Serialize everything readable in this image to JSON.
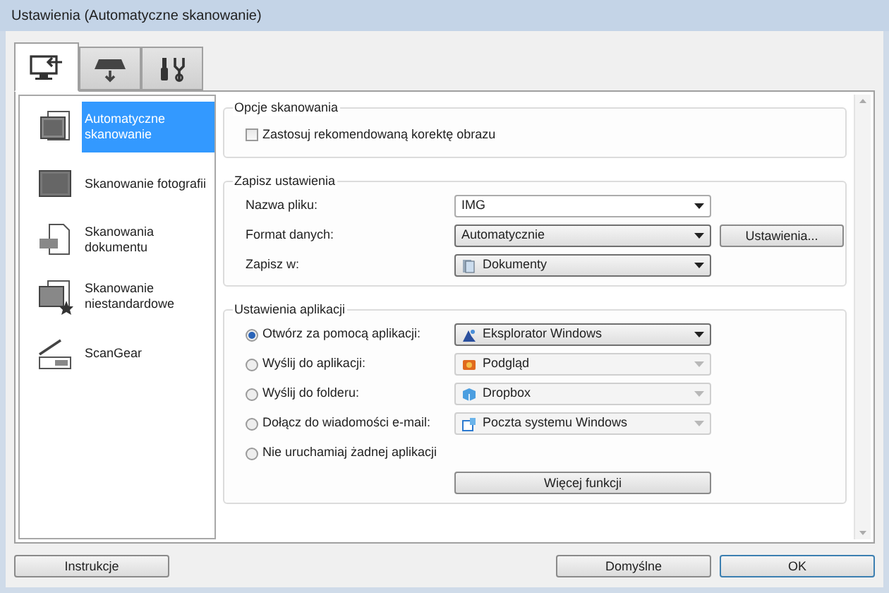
{
  "window": {
    "title": "Ustawienia (Automatyczne skanowanie)"
  },
  "tabs": [
    {
      "selected": true
    },
    {
      "selected": false
    },
    {
      "selected": false
    }
  ],
  "sidebar": {
    "items": [
      {
        "label": "Automatyczne skanowanie",
        "selected": true
      },
      {
        "label": "Skanowanie fotografii",
        "selected": false
      },
      {
        "label": "Skanowania dokumentu",
        "selected": false
      },
      {
        "label": "Skanowanie niestandardowe",
        "selected": false
      },
      {
        "label": "ScanGear",
        "selected": false
      }
    ]
  },
  "scan_options": {
    "title": "Opcje skanowania",
    "checkbox": {
      "label": "Zastosuj rekomendowaną korektę obrazu",
      "checked": false
    }
  },
  "save_settings": {
    "title": "Zapisz ustawienia",
    "rows": [
      {
        "label": "Nazwa pliku:",
        "kind": "combo",
        "value": "IMG"
      },
      {
        "label": "Format danych:",
        "kind": "select",
        "value": "Automatycznie",
        "button": "Ustawienia..."
      },
      {
        "label": "Zapisz w:",
        "kind": "select",
        "value": "Dokumenty"
      }
    ]
  },
  "app_settings": {
    "title": "Ustawienia aplikacji",
    "options": [
      {
        "label": "Otwórz za pomocą aplikacji:",
        "selected": true,
        "value": "Eksplorator Windows",
        "disabled": false
      },
      {
        "label": "Wyślij do aplikacji:",
        "selected": false,
        "value": "Podgląd",
        "disabled": true
      },
      {
        "label": "Wyślij do folderu:",
        "selected": false,
        "value": "Dropbox",
        "disabled": true
      },
      {
        "label": "Dołącz do wiadomości e-mail:",
        "selected": false,
        "value": "Poczta systemu Windows",
        "disabled": true
      },
      {
        "label": "Nie uruchamiaj żadnej aplikacji",
        "selected": false
      }
    ],
    "more_button": "Więcej funkcji"
  },
  "footer": {
    "left_button": "Instrukcje",
    "buttons": [
      "Domyślne",
      "OK"
    ]
  }
}
